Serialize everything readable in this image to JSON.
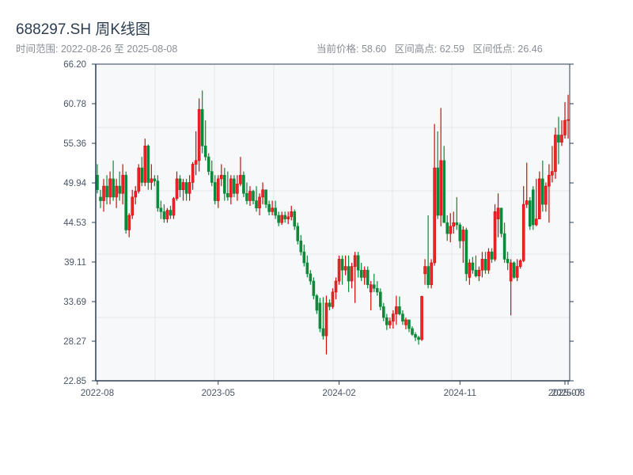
{
  "header": {
    "title": "688297.SH 周K线图",
    "range_label": "时间范围: 2022-08-26 至 2025-08-08",
    "current_price": "当前价格: 58.60",
    "range_high": "区间高点: 62.59",
    "range_low": "区间低点: 26.46"
  },
  "chart_data": {
    "type": "candlestick",
    "title": "688297.SH 周K线图",
    "ylim": [
      22.85,
      66.2
    ],
    "y_ticks": [
      "22.85",
      "28.27",
      "33.69",
      "39.11",
      "44.53",
      "49.94",
      "55.36",
      "60.78",
      "66.20"
    ],
    "x_ticks": [
      {
        "index": 0,
        "label": "2022-08"
      },
      {
        "index": 38,
        "label": "2023-05"
      },
      {
        "index": 76,
        "label": "2024-02"
      },
      {
        "index": 114,
        "label": "2024-11"
      },
      {
        "index": 147,
        "label": "2025-07"
      },
      {
        "index": 148,
        "label": "2025-08"
      }
    ],
    "grid": true,
    "colors": {
      "up": "#d40a0a",
      "down": "#0b8a3a",
      "background": "#f7f8fa",
      "axis": "#2c3e50",
      "grid": "#e3e6ec"
    },
    "ohlc_order": [
      "open",
      "high",
      "low",
      "close"
    ],
    "candles": [
      [
        51,
        52.5,
        48.5,
        49
      ],
      [
        48,
        49,
        46.5,
        47.5
      ],
      [
        47.5,
        50.5,
        46,
        49.5
      ],
      [
        49.5,
        51,
        47,
        48
      ],
      [
        48,
        51.5,
        47,
        50.5
      ],
      [
        50.5,
        53,
        47.5,
        48
      ],
      [
        48,
        50.5,
        46.5,
        49.5
      ],
      [
        49.5,
        51.5,
        47.5,
        48.5
      ],
      [
        48.5,
        52.5,
        47,
        51
      ],
      [
        51,
        51.5,
        43,
        43.5
      ],
      [
        43.5,
        45.8,
        42.5,
        45.5
      ],
      [
        45.5,
        49,
        45,
        48
      ],
      [
        48,
        49.5,
        47,
        48.8
      ],
      [
        48.8,
        52.5,
        48.5,
        52
      ],
      [
        52,
        53.5,
        49.5,
        50
      ],
      [
        50,
        56,
        49.5,
        55
      ],
      [
        55,
        55.2,
        49,
        50
      ],
      [
        50,
        52.5,
        49,
        50.5
      ],
      [
        50.5,
        51,
        49.5,
        50.2
      ],
      [
        50.2,
        51,
        46,
        46.5
      ],
      [
        46.5,
        47.5,
        45,
        46
      ],
      [
        46,
        47,
        44.5,
        45
      ],
      [
        45,
        46.5,
        44.5,
        46.2
      ],
      [
        46.2,
        46.8,
        45,
        45.5
      ],
      [
        45.5,
        48,
        45,
        47.8
      ],
      [
        47.8,
        51.5,
        47.5,
        50.5
      ],
      [
        50.5,
        51,
        48,
        49
      ],
      [
        49,
        50.5,
        47.5,
        50
      ],
      [
        50,
        50.5,
        47.5,
        48.5
      ],
      [
        48.5,
        51,
        47.5,
        50
      ],
      [
        50,
        52.8,
        49,
        52.5
      ],
      [
        52.5,
        57,
        51,
        53
      ],
      [
        53,
        61.5,
        51.5,
        60
      ],
      [
        60,
        62.59,
        54,
        55
      ],
      [
        55,
        58.5,
        53,
        53.5
      ],
      [
        53.5,
        54,
        51,
        51.5
      ],
      [
        51.5,
        53,
        49.5,
        50
      ],
      [
        50,
        51,
        47,
        47.5
      ],
      [
        47.5,
        51,
        46.5,
        50.5
      ],
      [
        50.5,
        52.5,
        49.5,
        51
      ],
      [
        51,
        52,
        47.5,
        48.5
      ],
      [
        48.5,
        51.5,
        47.5,
        48
      ],
      [
        48,
        51,
        47,
        50.5
      ],
      [
        50.5,
        51,
        48,
        48.5
      ],
      [
        48.5,
        51,
        47.5,
        49.8
      ],
      [
        49.8,
        53.5,
        49.5,
        51
      ],
      [
        51,
        51.5,
        48,
        48.5
      ],
      [
        48.5,
        50,
        47,
        47.5
      ],
      [
        47.5,
        49.5,
        46.8,
        48.8
      ],
      [
        48.8,
        49,
        47,
        47.5
      ],
      [
        47.5,
        49.5,
        46,
        46.5
      ],
      [
        46.5,
        48.5,
        45.5,
        48
      ],
      [
        48,
        50,
        47,
        49
      ],
      [
        49,
        49,
        46.5,
        47
      ],
      [
        47,
        47.5,
        45.5,
        46
      ],
      [
        46,
        47.5,
        45.5,
        46.5
      ],
      [
        46.5,
        47.5,
        45,
        45.5
      ],
      [
        45.5,
        46,
        44,
        44.5
      ],
      [
        44.5,
        46,
        44.2,
        45.5
      ],
      [
        45.5,
        46,
        44.5,
        45
      ],
      [
        45,
        46,
        44.3,
        45.3
      ],
      [
        45.3,
        46.8,
        44.8,
        46
      ],
      [
        46,
        46.3,
        43.5,
        44
      ],
      [
        44,
        44.5,
        41.5,
        42
      ],
      [
        42,
        42.8,
        40,
        40.5
      ],
      [
        40.5,
        41.5,
        38.5,
        39
      ],
      [
        39,
        40,
        37,
        37.5
      ],
      [
        37.5,
        38,
        36,
        36.5
      ],
      [
        36.5,
        37,
        34,
        34.5
      ],
      [
        34.5,
        34.7,
        32,
        32.5
      ],
      [
        33.5,
        34.2,
        29.5,
        30
      ],
      [
        30,
        34.3,
        28.5,
        29
      ],
      [
        29,
        34.5,
        26.46,
        33.5
      ],
      [
        33.5,
        34,
        32.5,
        33
      ],
      [
        33,
        35.5,
        32.7,
        35
      ],
      [
        35,
        37,
        34,
        36.5
      ],
      [
        36.5,
        40,
        36,
        39.5
      ],
      [
        39.5,
        40,
        36,
        38
      ],
      [
        38,
        40,
        37.3,
        38.5
      ],
      [
        38.5,
        40,
        35,
        36.5
      ],
      [
        36.5,
        39,
        35.5,
        38.5
      ],
      [
        38.5,
        40.5,
        33.5,
        40
      ],
      [
        40,
        40.5,
        37,
        38
      ],
      [
        38,
        39,
        36.5,
        37
      ],
      [
        37,
        38.5,
        36,
        38
      ],
      [
        38,
        38.5,
        35.5,
        36
      ],
      [
        35,
        36.5,
        32.5,
        36
      ],
      [
        36,
        37.5,
        35,
        35.5
      ],
      [
        35.5,
        36.5,
        34.5,
        35
      ],
      [
        35,
        35.5,
        32.5,
        33
      ],
      [
        33,
        33.5,
        31,
        31.5
      ],
      [
        31.5,
        32,
        29.8,
        30.5
      ],
      [
        30.5,
        31.5,
        30,
        31
      ],
      [
        31,
        32.5,
        30,
        32
      ],
      [
        32,
        34.5,
        30.5,
        33
      ],
      [
        33,
        34.4,
        31.8,
        32
      ],
      [
        32,
        32.5,
        30.5,
        31
      ],
      [
        30.5,
        31.5,
        29.9,
        31.2
      ],
      [
        31.2,
        31.2,
        29.5,
        30
      ],
      [
        30,
        30.3,
        29,
        29.2
      ],
      [
        29.2,
        29.5,
        28.3,
        28.8
      ],
      [
        28.8,
        29,
        27.8,
        28.5
      ],
      [
        28.5,
        34.5,
        28.3,
        34.4
      ],
      [
        37.5,
        39.5,
        36,
        38.5
      ],
      [
        38.5,
        45.5,
        35.5,
        36
      ],
      [
        36,
        39.5,
        35.5,
        39
      ],
      [
        39,
        58,
        38.6,
        52
      ],
      [
        52,
        57,
        45,
        45.5
      ],
      [
        45.5,
        60.2,
        44,
        53
      ],
      [
        53,
        55,
        45,
        44.5
      ],
      [
        44.5,
        45.5,
        42,
        43
      ],
      [
        43,
        45.8,
        41.8,
        44
      ],
      [
        44,
        46,
        43,
        44.5
      ],
      [
        44.5,
        48,
        43.5,
        44.2
      ],
      [
        44.2,
        44.5,
        41,
        42
      ],
      [
        42,
        44,
        39,
        43.5
      ],
      [
        43.5,
        43.8,
        36.5,
        37.5
      ],
      [
        37,
        39.5,
        36,
        39
      ],
      [
        39,
        39.8,
        37.5,
        38
      ],
      [
        38,
        40,
        37,
        37.2
      ],
      [
        37.2,
        38.5,
        36.5,
        38
      ],
      [
        38,
        40.5,
        37,
        39.5
      ],
      [
        39.5,
        40.5,
        37.5,
        38
      ],
      [
        38,
        41,
        37.5,
        40.5
      ],
      [
        40.5,
        41,
        39,
        39.5
      ],
      [
        39.5,
        47,
        39.2,
        46
      ],
      [
        45,
        48.5,
        42.5,
        46.5
      ],
      [
        46.5,
        46.5,
        42.5,
        43
      ],
      [
        43,
        44.5,
        39,
        39.5
      ],
      [
        39.5,
        40.5,
        38,
        39
      ],
      [
        36.5,
        39.5,
        31.8,
        39
      ],
      [
        39,
        39.2,
        36.8,
        37
      ],
      [
        37,
        39.5,
        36.5,
        38.5
      ],
      [
        38.5,
        39.5,
        38.2,
        39.3
      ],
      [
        39.3,
        49.5,
        39.1,
        47
      ],
      [
        47,
        52.7,
        46.5,
        47.5
      ],
      [
        47.5,
        48,
        43.5,
        44
      ],
      [
        49,
        49.5,
        43.5,
        44.2
      ],
      [
        44.2,
        50.5,
        44,
        45
      ],
      [
        45,
        51.5,
        45,
        50.5
      ],
      [
        50.5,
        53,
        46,
        47
      ],
      [
        47,
        50,
        46,
        49.5
      ],
      [
        49.5,
        52.5,
        44.5,
        51
      ],
      [
        51,
        55,
        50,
        51.5
      ],
      [
        51.5,
        57.5,
        50.5,
        56.5
      ],
      [
        56.5,
        59,
        52.5,
        55.5
      ],
      [
        55.5,
        58.5,
        55,
        56.5
      ],
      [
        56.5,
        61,
        56,
        58.5
      ],
      [
        58.5,
        62,
        56,
        58.6
      ]
    ]
  }
}
